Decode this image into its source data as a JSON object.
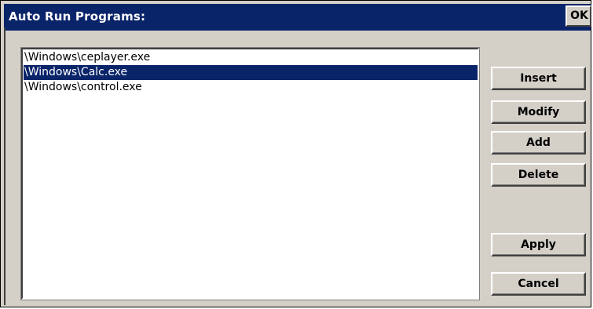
{
  "dialog": {
    "title": "Auto Run Programs:",
    "ok_label": "OK"
  },
  "program_list": {
    "items": [
      {
        "path": "\\Windows\\ceplayer.exe",
        "selected": false
      },
      {
        "path": "\\Windows\\Calc.exe",
        "selected": true
      },
      {
        "path": "\\Windows\\control.exe",
        "selected": false
      }
    ]
  },
  "buttons": {
    "insert": "Insert",
    "modify": "Modify",
    "add": "Add",
    "delete": "Delete",
    "apply": "Apply",
    "cancel": "Cancel"
  },
  "colors": {
    "title_bar": "#0a246a",
    "selection": "#0a246a",
    "face": "#d4d0c8"
  }
}
